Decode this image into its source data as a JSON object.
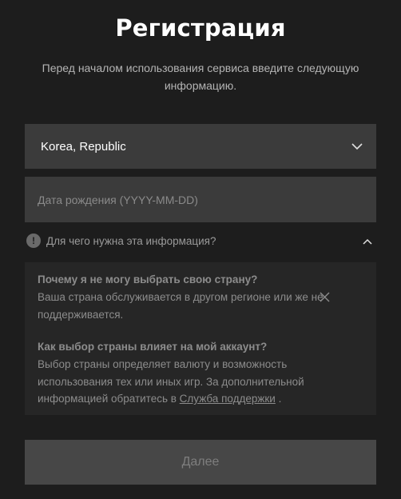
{
  "header": {
    "title": "Регистрация",
    "subtitle": "Перед началом использования сервиса введите следующую информацию."
  },
  "country": {
    "selected": "Korea, Republic",
    "icon": "chevron-down-icon"
  },
  "birthdate": {
    "value": "",
    "placeholder": "Дата рождения (YYYY-MM-DD)"
  },
  "info": {
    "toggle_label": "Для чего нужна эта информация?",
    "icon": "exclamation-icon",
    "expanded": true
  },
  "faq": [
    {
      "question": "Почему я не могу выбрать свою страну?",
      "answer": "Ваша страна обслуживается в другом регионе или же не поддерживается."
    },
    {
      "question": "Как выбор страны влияет на мой аккаунт?",
      "answer": "Выбор страны определяет валюту и возможность использования тех или иных игр. За дополнительной информацией обратитесь в ",
      "link": "Служба поддержки",
      "suffix": " ."
    }
  ],
  "actions": {
    "next_label": "Далее"
  },
  "colors": {
    "background": "#1d1d1d",
    "field": "#3b3b3b",
    "panel": "#262626",
    "button_disabled": "#474747"
  }
}
